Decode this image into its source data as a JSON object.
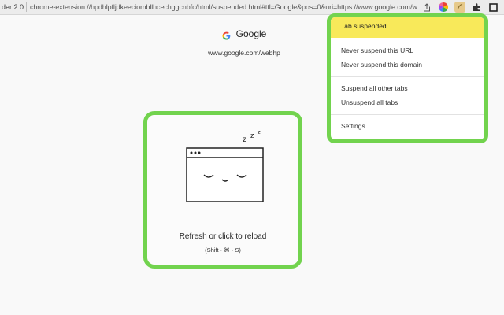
{
  "browser": {
    "tab_title": "der 2.0",
    "url": "chrome-extension://hpdhlpfljdkeeciombllhcechggcnbfc/html/suspended.html#ttl=Google&pos=0&uri=https://www.google.com/web..."
  },
  "page": {
    "title": "Google",
    "url": "www.google.com/webhp",
    "reload_text": "Refresh or click to reload",
    "shortcut": "(Shift · ⌘ · S)"
  },
  "popup": {
    "status": "Tab suspended",
    "items": [
      "Never suspend this URL",
      "Never suspend this domain",
      "Suspend all other tabs",
      "Unsuspend all tabs",
      "Settings"
    ]
  },
  "colors": {
    "accent_green": "#72d34e",
    "status_yellow": "#f8e95a"
  },
  "icons": [
    "share-icon",
    "color-wheel-icon",
    "suspender-extension-icon",
    "puzzle-icon",
    "window-icon",
    "google-g-icon",
    "sleeping-window-icon"
  ]
}
